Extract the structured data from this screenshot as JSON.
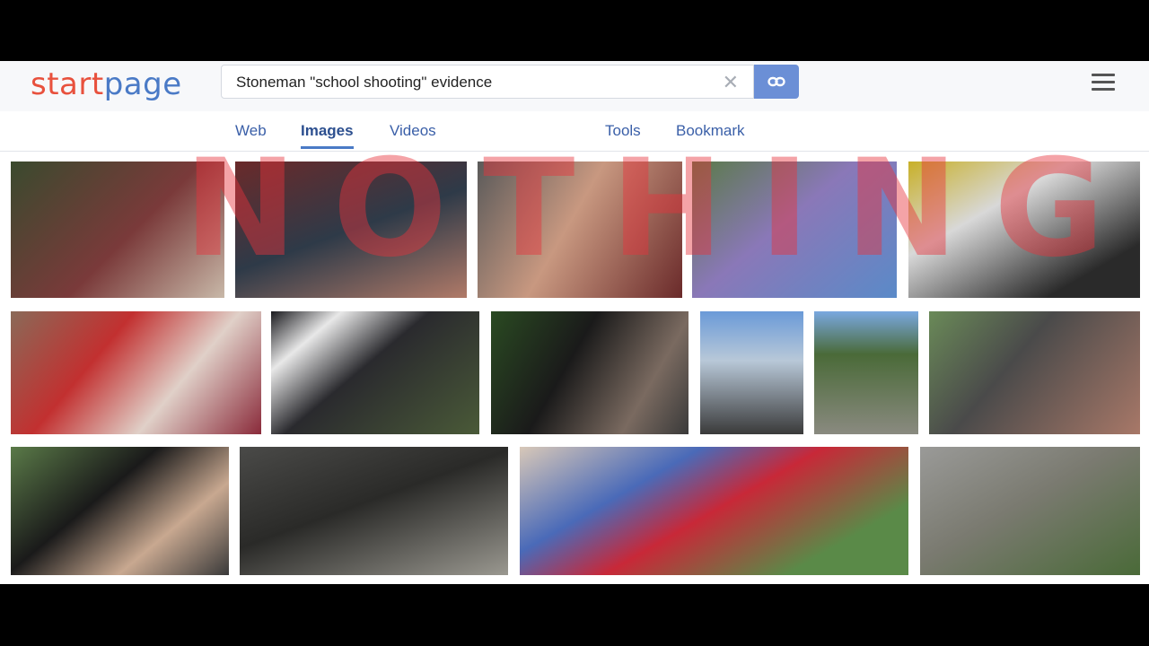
{
  "logo": {
    "part1": "start",
    "part2": "page"
  },
  "search": {
    "query": "Stoneman \"school shooting\" evidence",
    "clear_icon": "close-icon",
    "go_icon": "link-icon"
  },
  "tabs": [
    {
      "label": "Web"
    },
    {
      "label": "Images",
      "active": true
    },
    {
      "label": "Videos"
    },
    {
      "label": "Tools"
    },
    {
      "label": "Bookmark"
    }
  ],
  "overlay": {
    "text": "NOTHING"
  },
  "colors": {
    "brand_red": "#e8513d",
    "brand_blue": "#4a7ac6",
    "go_button": "#6b8fd6",
    "tab_text": "#3a5fa8"
  },
  "image_results": [
    {
      "name": "image-result-1"
    },
    {
      "name": "image-result-2"
    },
    {
      "name": "image-result-3"
    },
    {
      "name": "image-result-4"
    },
    {
      "name": "image-result-5"
    },
    {
      "name": "image-result-6"
    },
    {
      "name": "image-result-7"
    },
    {
      "name": "image-result-8"
    },
    {
      "name": "image-result-9"
    },
    {
      "name": "image-result-10"
    },
    {
      "name": "image-result-11"
    },
    {
      "name": "image-result-12"
    },
    {
      "name": "image-result-13"
    },
    {
      "name": "image-result-14"
    },
    {
      "name": "image-result-15"
    },
    {
      "name": "image-result-16"
    }
  ]
}
